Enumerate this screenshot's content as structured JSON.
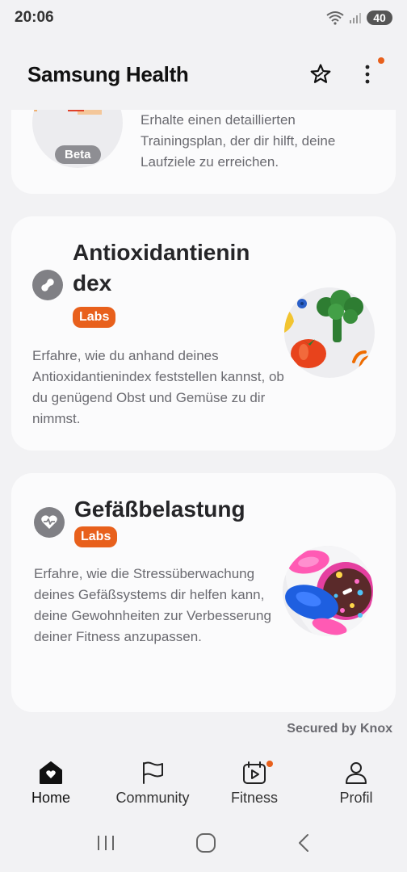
{
  "status_bar": {
    "time": "20:06",
    "battery": "40"
  },
  "header": {
    "title": "Samsung Health"
  },
  "cards": {
    "running_plan": {
      "badge": "Beta",
      "description": "Erhalte einen detaillierten Trainingsplan, der dir hilft, deine Laufziele zu erreichen."
    },
    "antioxidant": {
      "title": "Antioxidantienin dex",
      "badge": "Labs",
      "description": "Erfahre, wie du anhand deines Antioxidantienindex feststellen kannst, ob du genügend Obst und Gemüse zu dir nimmst."
    },
    "vascular": {
      "title": "Gefäßbelastung",
      "badge": "Labs",
      "description": "Erfahre, wie die Stressüberwachung deines Gefäßsystems dir helfen kann, deine Gewohnheiten zur Verbesserung deiner Fitness anzupassen."
    }
  },
  "footer_note": "Secured by Knox",
  "bottom_nav": [
    {
      "label": "Home",
      "icon": "home-icon"
    },
    {
      "label": "Community",
      "icon": "flag-icon"
    },
    {
      "label": "Fitness",
      "icon": "fitness-calendar-icon"
    },
    {
      "label": "Profil",
      "icon": "profile-icon"
    }
  ],
  "colors": {
    "accent": "#e8601c",
    "card_bg": "#fbfbfc",
    "page_bg": "#f2f2f4",
    "icon_grey": "#808085"
  }
}
